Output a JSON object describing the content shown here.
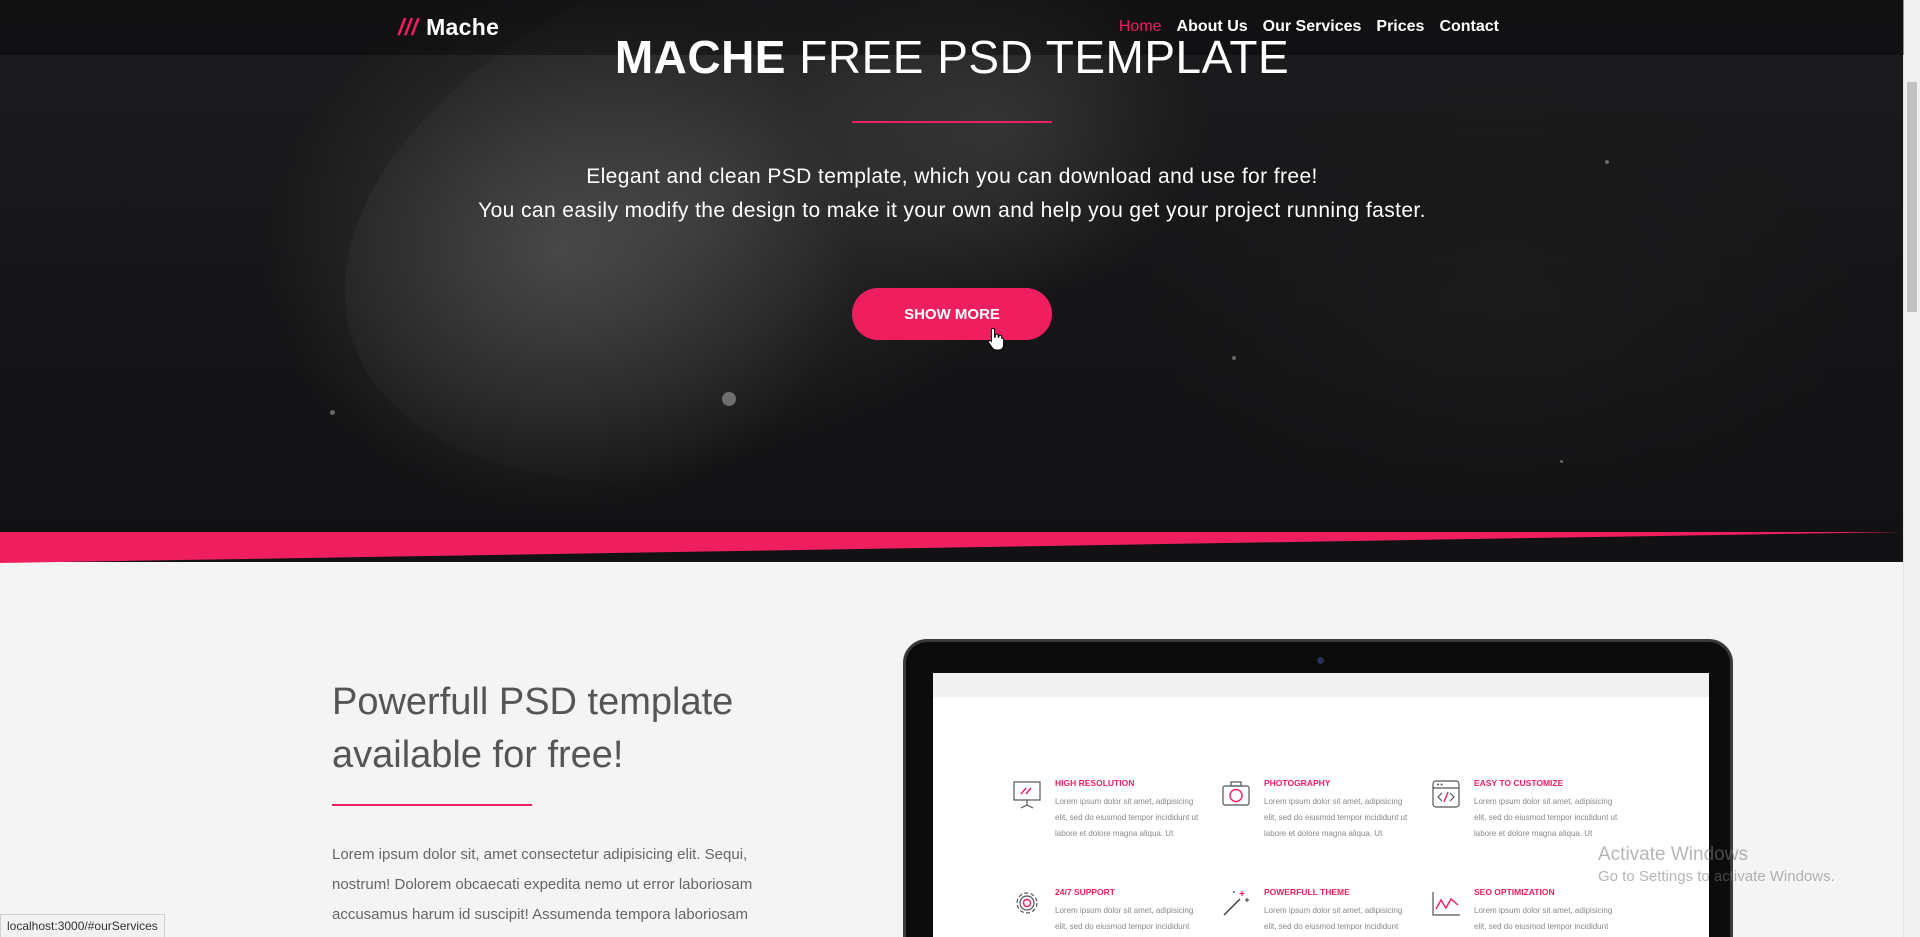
{
  "brand": {
    "slashes": "///",
    "name": "Mache"
  },
  "nav": {
    "items": [
      {
        "label": "Home",
        "active": true
      },
      {
        "label": "About Us",
        "active": false
      },
      {
        "label": "Our Services",
        "active": false
      },
      {
        "label": "Prices",
        "active": false
      },
      {
        "label": "Contact",
        "active": false
      }
    ]
  },
  "hero": {
    "title_bold": "MACHE",
    "title_rest": " FREE PSD TEMPLATE",
    "line1": "Elegant and clean PSD template, which you can download and use for free!",
    "line2": "You can easily modify the design to make it your own and help you get your project running faster.",
    "button_label": "SHOW MORE"
  },
  "section": {
    "title_line1": "Powerfull PSD template",
    "title_line2": "available for free!",
    "text": "Lorem ipsum dolor sit, amet consectetur adipisicing elit. Sequi, nostrum! Dolorem obcaecati expedita nemo ut error laboriosam accusamus harum id suscipit! Assumenda tempora laboriosam"
  },
  "laptop_features": [
    {
      "icon": "presentation-icon",
      "title": "HIGH RESOLUTION",
      "desc": "Lorem ipsum dolor sit amet, adipisicing elit, sed do eiusmod tempor incididunt ut labore et dolore magna aliqua. Ut"
    },
    {
      "icon": "camera-icon",
      "title": "PHOTOGRAPHY",
      "desc": "Lorem ipsum dolor sit amet, adipisicing elit, sed do eiusmod tempor incididunt ut labore et dolore magna aliqua. Ut"
    },
    {
      "icon": "code-window-icon",
      "title": "EASY TO CUSTOMIZE",
      "desc": "Lorem ipsum dolor sit amet, adipisicing elit, sed do eiusmod tempor incididunt ut labore et dolore magna aliqua. Ut"
    },
    {
      "icon": "gear-icon",
      "title": "24/7 SUPPORT",
      "desc": "Lorem ipsum dolor sit amet, adipisicing elit, sed do eiusmod tempor incididunt"
    },
    {
      "icon": "magic-wand-icon",
      "title": "POWERFULL THEME",
      "desc": "Lorem ipsum dolor sit amet, adipisicing elit, sed do eiusmod tempor incididunt"
    },
    {
      "icon": "line-chart-icon",
      "title": "SEO OPTIMIZATION",
      "desc": "Lorem ipsum dolor sit amet, adipisicing elit, sed do eiusmod tempor incididunt"
    }
  ],
  "watermark": {
    "title": "Activate Windows",
    "subtitle": "Go to Settings to activate Windows."
  },
  "status_bar": {
    "url": "localhost:3000/#ourServices"
  },
  "colors": {
    "accent": "#ef1f5f",
    "hero_bg": "#151416",
    "page_bg": "#f4f4f4"
  }
}
